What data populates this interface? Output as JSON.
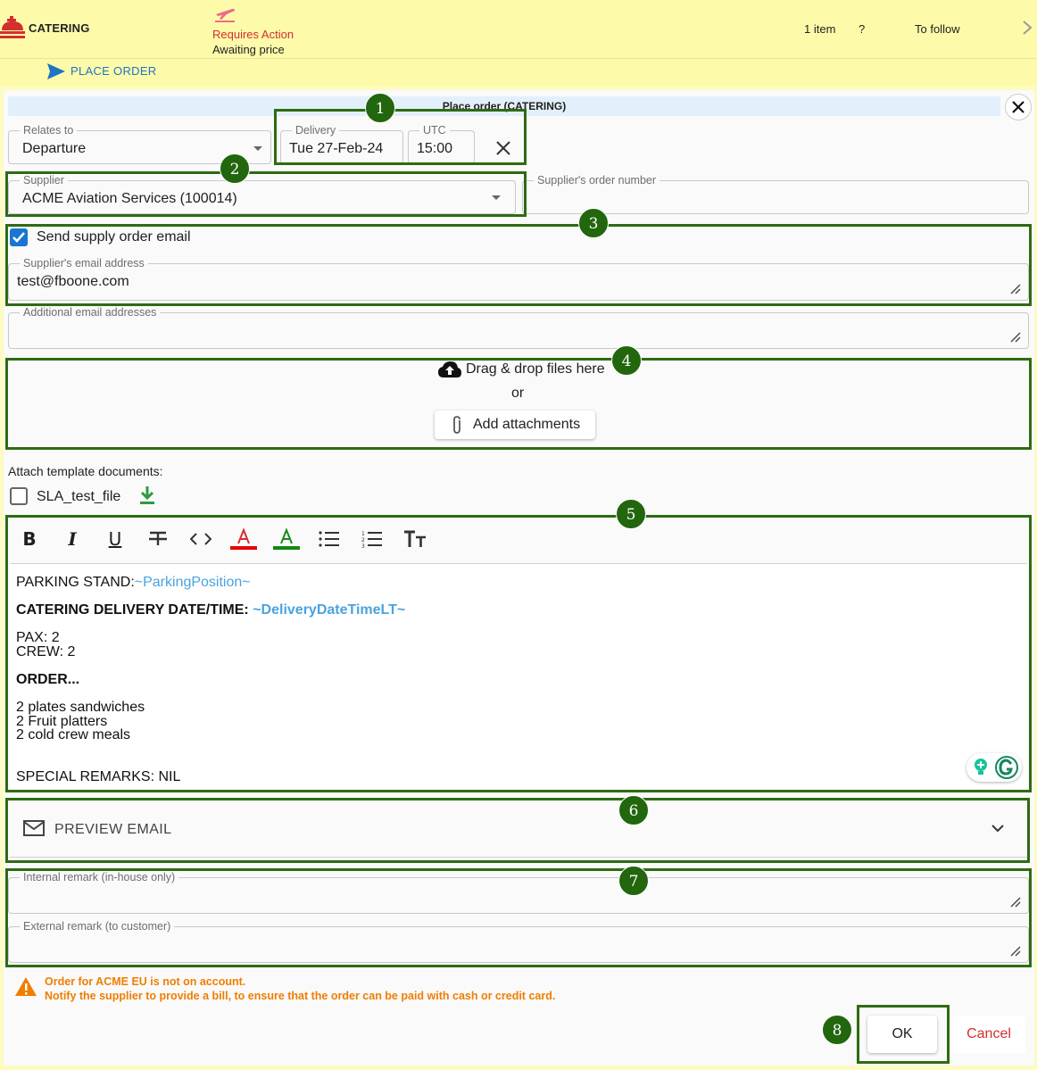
{
  "topbar": {
    "category": "CATERING",
    "status_main": "Requires Action",
    "status_sub": "Awaiting price",
    "items_count": "1 item",
    "question": "?",
    "to_follow": "To follow",
    "status_color": "#d32f2f"
  },
  "action": {
    "place_order": "PLACE ORDER"
  },
  "dialog": {
    "title": "Place order (CATERING)",
    "relates_to": {
      "label": "Relates to",
      "value": "Departure"
    },
    "delivery": {
      "label": "Delivery",
      "value": "Tue 27-Feb-24"
    },
    "utc": {
      "label": "UTC",
      "value": "15:00"
    },
    "supplier": {
      "label": "Supplier",
      "value": "ACME Aviation Services (100014)"
    },
    "supplier_order_number": {
      "label": "Supplier's order number",
      "value": ""
    },
    "send_email": {
      "label": "Send supply order email",
      "checked": true
    },
    "supplier_email": {
      "label": "Supplier's email address",
      "value": "test@fboone.com"
    },
    "additional_emails": {
      "label": "Additional email addresses",
      "value": ""
    },
    "dropzone": {
      "text": "Drag & drop files here",
      "or": "or",
      "button": "Add attachments"
    },
    "template_docs": {
      "label": "Attach template documents:",
      "items": [
        {
          "name": "SLA_test_file",
          "checked": false
        }
      ]
    },
    "editor": {
      "toolbar": [
        "bold-icon",
        "italic-icon",
        "underline-icon",
        "strikethrough-icon",
        "code-icon",
        "text-color-icon",
        "highlight-color-icon",
        "bullet-list-icon",
        "numbered-list-icon",
        "text-size-icon"
      ],
      "parking_label": "PARKING STAND:",
      "parking_var": "~ParkingPosition~",
      "delivery_label": "CATERING DELIVERY DATE/TIME: ",
      "delivery_var": "~DeliveryDateTimeLT~",
      "pax": "PAX: 2",
      "crew": "CREW: 2",
      "order": "ORDER...",
      "order_line1": "2 plates sandwiches",
      "order_line2": "2 Fruit platters",
      "order_line3": "2 cold crew meals",
      "remarks": "SPECIAL REMARKS: NIL"
    },
    "preview_email": "PREVIEW EMAIL",
    "internal_remark": {
      "label": "Internal remark (in-house only)",
      "value": ""
    },
    "external_remark": {
      "label": "External remark (to customer)",
      "value": ""
    },
    "warning": {
      "line1": "Order for ACME EU is not on account.",
      "line2": "Notify the supplier to provide a bill, to ensure that the order can be paid with cash or credit card.",
      "color": "#f07d00"
    },
    "ok": "OK",
    "cancel": "Cancel"
  },
  "annotations": [
    "1",
    "2",
    "3",
    "4",
    "5",
    "6",
    "7",
    "8"
  ],
  "colors": {
    "accent": "#1976d2",
    "annotation": "#22660e",
    "background": "#fdfbaa"
  }
}
